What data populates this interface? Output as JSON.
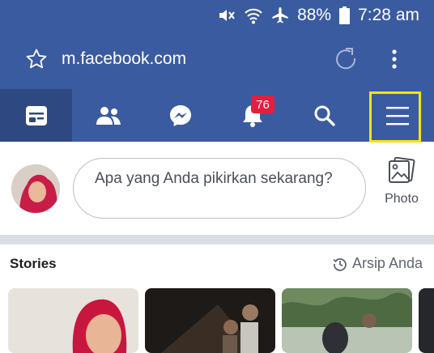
{
  "status_bar": {
    "battery": "88%",
    "time": "7:28 am"
  },
  "browser": {
    "url": "m.facebook.com"
  },
  "nav": {
    "notifications_badge": "76"
  },
  "composer": {
    "placeholder": "Apa yang Anda pikirkan sekarang?",
    "photo_label": "Photo"
  },
  "stories": {
    "title": "Stories",
    "archive_label": "Arsip Anda"
  },
  "colors": {
    "header": "#3b5ba0",
    "active_tab": "#2e4882",
    "highlight": "#f5e50b",
    "badge": "#e41e3f"
  }
}
